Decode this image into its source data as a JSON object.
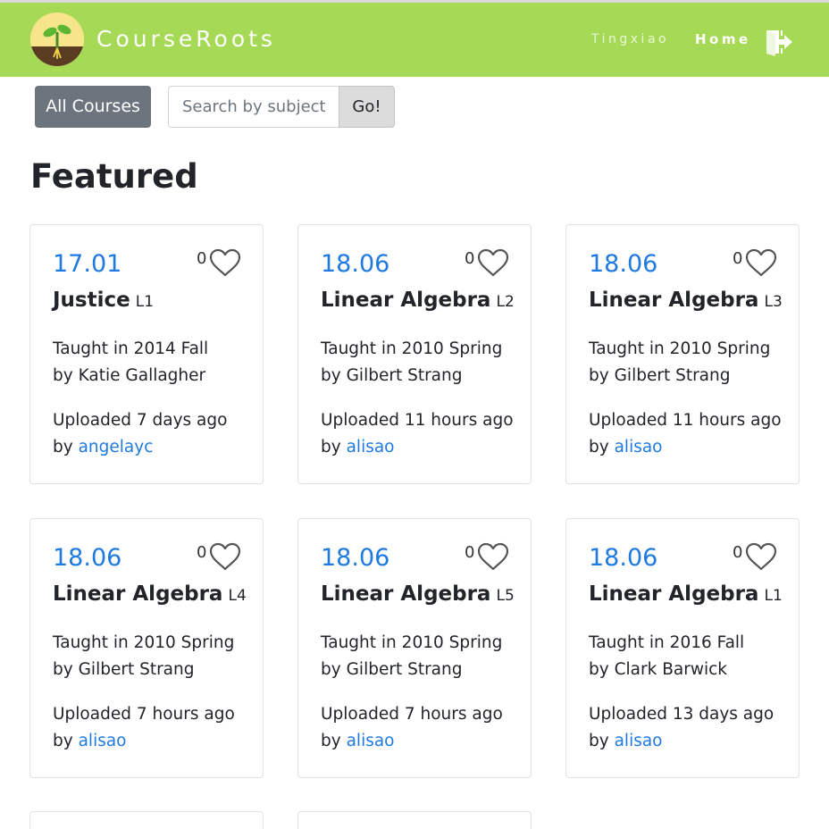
{
  "header": {
    "brand": "CourseRoots",
    "user": "Tingxiao",
    "home": "Home",
    "logout_icon": "logout-icon",
    "background_color": "#a6da56"
  },
  "toolbar": {
    "all_courses_label": "All Courses",
    "search_placeholder": "Search by subject",
    "go_label": "Go!"
  },
  "main": {
    "section_title": "Featured",
    "taught_prefix": "Taught in",
    "by_prefix": "by",
    "uploaded_prefix": "Uploaded",
    "cards": [
      {
        "code": "17.01",
        "likes": "0",
        "title": "Justice",
        "level": "L1",
        "term": "2014 Fall",
        "instructor": "Katie Gallagher",
        "uploaded": "7 days ago",
        "uploader": "angelayc"
      },
      {
        "code": "18.06",
        "likes": "0",
        "title": "Linear Algebra",
        "level": "L2",
        "term": "2010 Spring",
        "instructor": "Gilbert Strang",
        "uploaded": "11 hours ago",
        "uploader": "alisao"
      },
      {
        "code": "18.06",
        "likes": "0",
        "title": "Linear Algebra",
        "level": "L3",
        "term": "2010 Spring",
        "instructor": "Gilbert Strang",
        "uploaded": "11 hours ago",
        "uploader": "alisao"
      },
      {
        "code": "18.06",
        "likes": "0",
        "title": "Linear Algebra",
        "level": "L4",
        "term": "2010 Spring",
        "instructor": "Gilbert Strang",
        "uploaded": "7 hours ago",
        "uploader": "alisao"
      },
      {
        "code": "18.06",
        "likes": "0",
        "title": "Linear Algebra",
        "level": "L5",
        "term": "2010 Spring",
        "instructor": "Gilbert Strang",
        "uploaded": "7 hours ago",
        "uploader": "alisao"
      },
      {
        "code": "18.06",
        "likes": "0",
        "title": "Linear Algebra",
        "level": "L1",
        "term": "2016 Fall",
        "instructor": "Clark Barwick",
        "uploaded": "13 days ago",
        "uploader": "alisao"
      }
    ]
  },
  "colors": {
    "accent_blue": "#1f7ae0",
    "secondary_button": "#6c757d"
  }
}
